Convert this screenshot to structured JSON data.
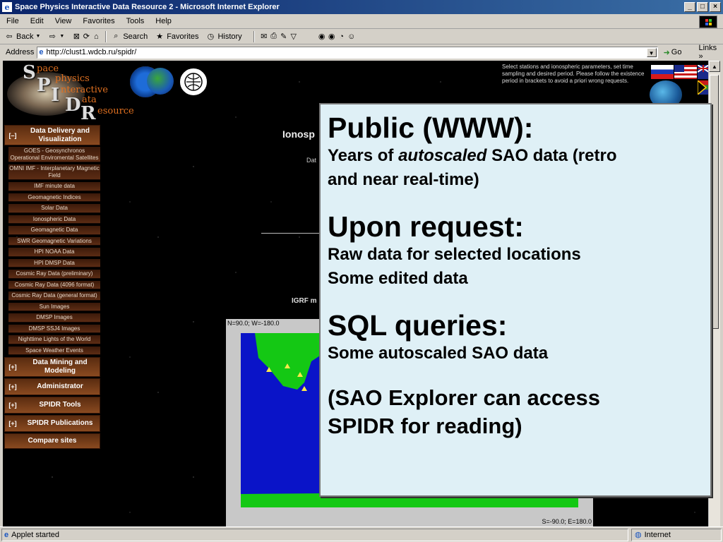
{
  "window": {
    "title": "Space Physics Interactive Data Resource 2 - Microsoft Internet Explorer"
  },
  "menu": [
    "File",
    "Edit",
    "View",
    "Favorites",
    "Tools",
    "Help"
  ],
  "toolbar": {
    "back": "Back",
    "search": "Search",
    "favorites": "Favorites",
    "history": "History"
  },
  "address": {
    "label": "Address",
    "url": "http://clust1.wdcb.ru/spidr/",
    "go": "Go",
    "links": "Links"
  },
  "logo": {
    "letters": [
      "S",
      "P",
      "I",
      "D",
      "R"
    ],
    "words": [
      "pace",
      "physics",
      "nteractive",
      "ata",
      "esource"
    ]
  },
  "sidebar": {
    "sections": [
      {
        "toggle": "[–]",
        "label": "Data Delivery and Visualization"
      },
      {
        "toggle": "[+]",
        "label": "Data Mining and Modeling"
      },
      {
        "toggle": "[+]",
        "label": "Administrator"
      },
      {
        "toggle": "[+]",
        "label": "SPIDR Tools"
      },
      {
        "toggle": "[+]",
        "label": "SPIDR Publications"
      },
      {
        "toggle": "",
        "label": "Compare sites"
      }
    ],
    "items": [
      "GOES - Geosynchronos Operational Enviromental Satellites",
      "OMNI IMF - Interplanetary Magnetic Field",
      "IMF minute data",
      "Geomagnetic Indices",
      "Solar Data",
      "Ionospheric Data",
      "Geomagnetic Data",
      "SWR Geomagnetic Variations",
      "HPI NOAA Data",
      "HPI DMSP Data",
      "Cosmic Ray Data (preliminary)",
      "Cosmic Ray Data (4096 format)",
      "Cosmic Ray Data (general format)",
      "Sun Images",
      "DMSP Images",
      "DMSP SSJ4 Images",
      "Nighttime Lights of the World",
      "Space Weather Events"
    ]
  },
  "page": {
    "right_text": "Select stations and ionospheric parameters, set time sampling and desired period. Please follow the existence period in brackets to avoid a priori wrong requests.",
    "title_fragment": "Ionosp",
    "dat_fragment": "Dat",
    "igrf_fragment": "IGRF m",
    "map_nw": "N=90.0; W=-180.0",
    "map_se": "S=-90.0; E=180.0"
  },
  "overlay": {
    "h1": "Public (WWW):",
    "b1a_pre": "Years of ",
    "b1a_em": "autoscaled",
    "b1a_post": " SAO data (retro",
    "b1b": "and near real-time)",
    "h2": "Upon request:",
    "b2a": "Raw data for selected locations",
    "b2b": "Some edited data",
    "h3": "SQL queries:",
    "b3": "Some autoscaled SAO data",
    "b4a": "(SAO Explorer can access",
    "b4b": "SPIDR for reading)"
  },
  "status": {
    "text": "Applet started",
    "zone": "Internet"
  },
  "colors": {
    "title_bar": "#0a246a",
    "overlay_bg": "#dff0f6",
    "map_ocean": "#0a14c8",
    "map_land": "#14c814",
    "sidebar_bg": "#5a2c10"
  }
}
